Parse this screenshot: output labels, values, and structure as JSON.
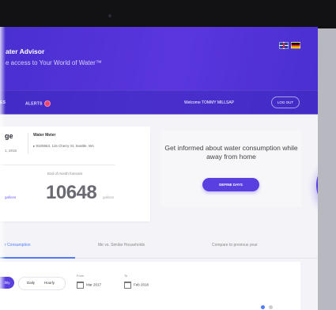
{
  "header": {
    "title": "ater Advisor",
    "tagline": "e access to Your World of Water™"
  },
  "nav": {
    "partial_item": "ES",
    "alerts": "ALERTS",
    "welcome": "Welcome TOMMY MILLSAP",
    "logout": "LOG OUT"
  },
  "meter_card": {
    "heading": "ge",
    "date": "1, 2016",
    "meter_label": "Water Meter",
    "address": "▸ 9325963, 115 Cherry St, Seattle, WA",
    "forecast_label": "End of month forecast",
    "forecast_value": "10648",
    "forecast_unit": "gallons",
    "left_unit": "gallons"
  },
  "promo": {
    "text": "Get informed about water consumption while away from home",
    "button": "DEFINE DAYS"
  },
  "tabs": [
    {
      "label": "r Consumption",
      "active": true
    },
    {
      "label": "Me vs. Similar Households",
      "active": false
    },
    {
      "label": "Compare to previous year",
      "active": false
    }
  ],
  "filters": {
    "hourly_partial": "thly",
    "daily": "Daily",
    "hourly": "Hourly",
    "from_label": "From",
    "from_value": "Mar 2017",
    "to_label": "To",
    "to_value": "Feb 2018"
  },
  "peek": {
    "c": "c",
    "a": "a"
  },
  "colors": {
    "accent": "#5a3fe0",
    "link": "#4f7cff",
    "alert": "#e8456e"
  }
}
